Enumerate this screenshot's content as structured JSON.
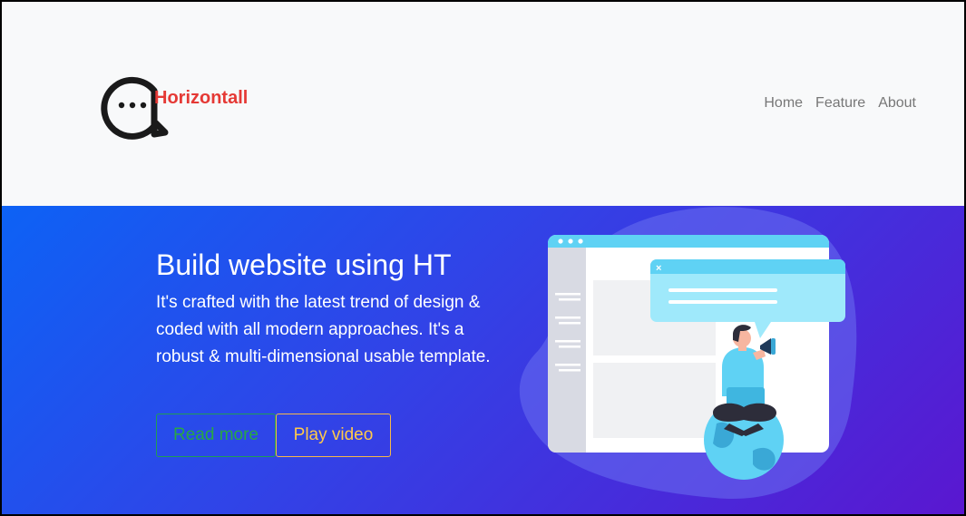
{
  "brand": {
    "name": "Horizontall",
    "logo_icon": "chat-bubble-dots-icon",
    "color": "#e53935"
  },
  "nav": {
    "items": [
      {
        "label": "Home"
      },
      {
        "label": "Feature"
      },
      {
        "label": "About"
      }
    ]
  },
  "hero": {
    "title": "Build website using HT",
    "description": "It's crafted with the latest trend of design & coded with all modern approaches. It's a robust & multi-dimensional usable template.",
    "buttons": {
      "read_more": "Read more",
      "play_video": "Play video"
    },
    "illustration_icon": "person-with-megaphone-illustration",
    "colors": {
      "gradient_start": "#0d62f5",
      "gradient_end": "#5a17d0",
      "read_more": "#28a745",
      "play_video": "#ffc94a"
    }
  }
}
